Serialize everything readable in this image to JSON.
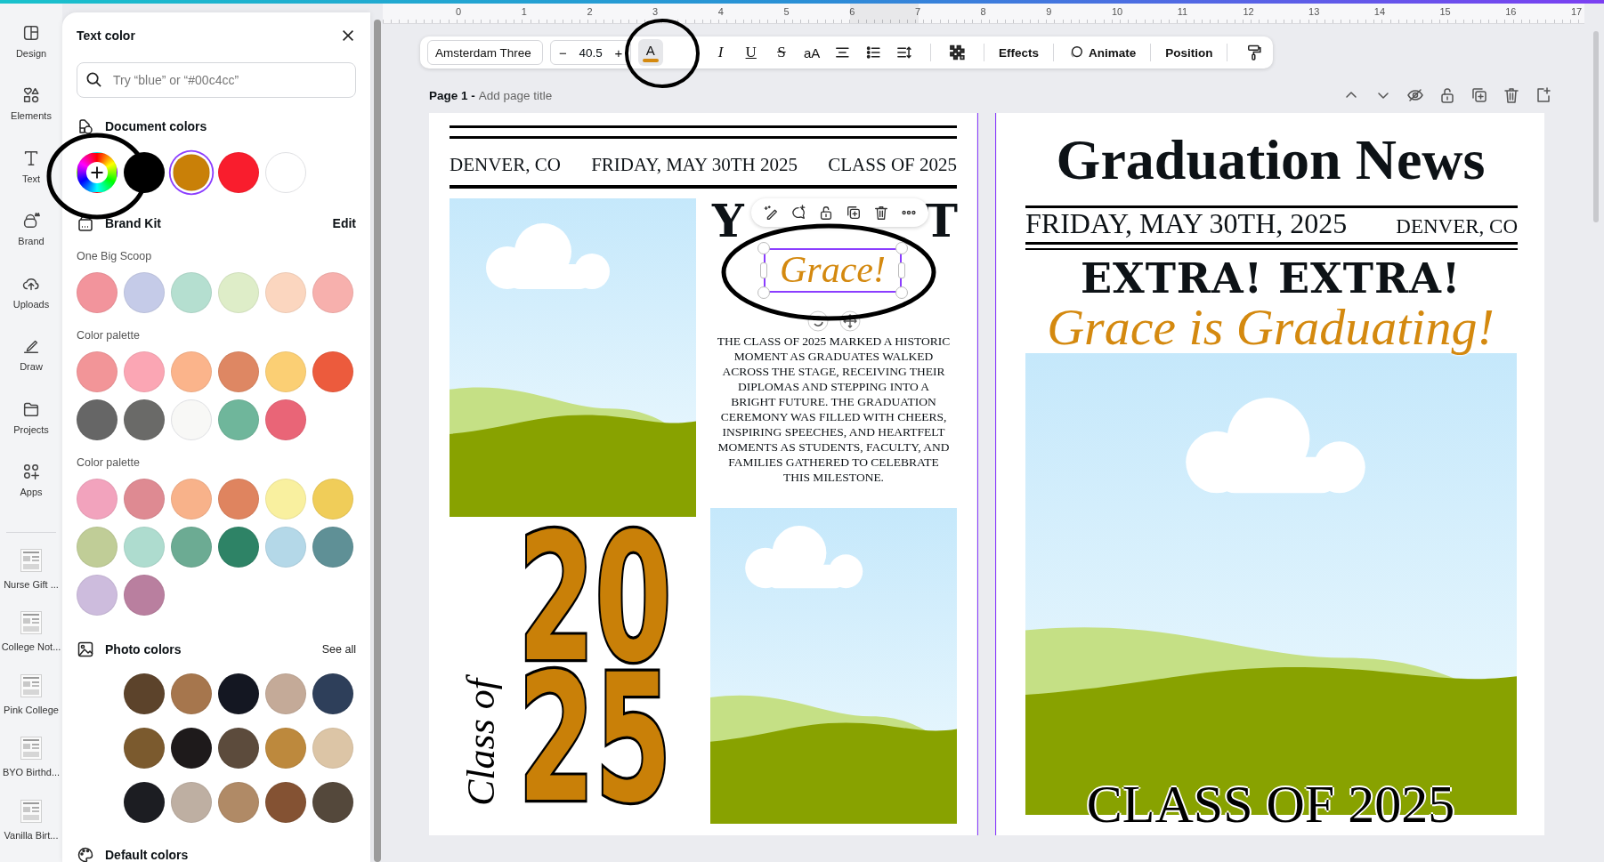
{
  "rail": {
    "items": [
      {
        "kind": "design",
        "label": "Design"
      },
      {
        "kind": "elements",
        "label": "Elements"
      },
      {
        "kind": "text",
        "label": "Text"
      },
      {
        "kind": "brand",
        "label": "Brand"
      },
      {
        "kind": "uploads",
        "label": "Uploads"
      },
      {
        "kind": "draw",
        "label": "Draw"
      },
      {
        "kind": "projects",
        "label": "Projects"
      },
      {
        "kind": "apps",
        "label": "Apps"
      }
    ],
    "recent": [
      {
        "label": "Nurse Gift ..."
      },
      {
        "label": "College Not..."
      },
      {
        "label": "Pink College"
      },
      {
        "label": "BYO Birthd..."
      },
      {
        "label": "Vanilla Birt..."
      }
    ]
  },
  "panel": {
    "title": "Text color",
    "search": {
      "placeholder": "Try “blue” or “#00c4cc”"
    },
    "document_colors": {
      "title": "Document colors",
      "swatches": [
        {
          "color": "#000000",
          "selected": false
        },
        {
          "color": "#c98008",
          "selected": true
        },
        {
          "color": "#f91d2d",
          "selected": false
        },
        {
          "color": "#ffffff",
          "selected": false
        }
      ]
    },
    "brand_kit": {
      "title": "Brand Kit",
      "action": "Edit",
      "palettes": [
        {
          "name": "One Big Scoop",
          "colors": [
            {
              "color": "#f2949c"
            },
            {
              "color": "#c5cbe8"
            },
            {
              "color": "#b5dfd0"
            },
            {
              "color": "#deedc8"
            },
            {
              "color": "#fbd6bf"
            },
            {
              "color": "#f7b0ad"
            }
          ]
        },
        {
          "name": "Color palette",
          "colors": [
            {
              "color": "#f29598"
            },
            {
              "color": "#fba6b4"
            },
            {
              "color": "#fbb48b"
            },
            {
              "color": "#de8763"
            },
            {
              "color": "#fbcf74"
            },
            {
              "color": "#ec5b3d"
            },
            {
              "color": "#666666"
            },
            {
              "color": "#6a6a68"
            },
            {
              "color": "#f8f8f6"
            },
            {
              "color": "#6fb69b"
            },
            {
              "color": "#e96577"
            }
          ]
        },
        {
          "name": "Color palette",
          "colors": [
            {
              "color": "#f2a3bd"
            },
            {
              "color": "#de8a92"
            },
            {
              "color": "#f8b28a"
            },
            {
              "color": "#df845f"
            },
            {
              "color": "#f9f09f"
            },
            {
              "color": "#f0cd59"
            },
            {
              "color": "#c0cd97"
            },
            {
              "color": "#aedccf"
            },
            {
              "color": "#6cab93"
            },
            {
              "color": "#2e8366"
            },
            {
              "color": "#b4d8e8"
            },
            {
              "color": "#5f9096"
            },
            {
              "color": "#cdbcdd"
            },
            {
              "color": "#b97f9f"
            }
          ]
        }
      ]
    },
    "photo_colors": {
      "title": "Photo colors",
      "action": "See all",
      "colors": [
        {
          "color": "#5c432b"
        },
        {
          "color": "#a6764d"
        },
        {
          "color": "#141722"
        },
        {
          "color": "#c4aa98"
        },
        {
          "color": "#2e3f5a"
        },
        {
          "color": "#7b5a2e"
        },
        {
          "color": "#1e1a1b"
        },
        {
          "color": "#5c4b3c"
        },
        {
          "color": "#bd893d"
        },
        {
          "color": "#dcc5a6"
        },
        {
          "color": "#1c1d22"
        },
        {
          "color": "#beafa2"
        },
        {
          "color": "#b08a66"
        },
        {
          "color": "#845233"
        },
        {
          "color": "#54483b"
        }
      ]
    },
    "default_colors": {
      "title": "Default colors"
    }
  },
  "ruler": [
    "0",
    "1",
    "2",
    "3",
    "4",
    "5",
    "6",
    "7",
    "8",
    "9",
    "10",
    "11",
    "12",
    "13",
    "14",
    "15",
    "16",
    "17"
  ],
  "toolbar": {
    "font": "Amsterdam Three",
    "size": {
      "minus": "−",
      "value": "40.5",
      "plus": "+"
    },
    "text_color": {
      "label": "A",
      "color": "#d4890f"
    },
    "format": [
      {
        "kind": "italic",
        "label": "I"
      },
      {
        "kind": "underline",
        "label": "U"
      },
      {
        "kind": "strike",
        "label": "S"
      },
      {
        "kind": "case",
        "label": "aA"
      }
    ],
    "effects": "Effects",
    "animate": "Animate",
    "position": "Position"
  },
  "page_header": {
    "label": "Page 1 -",
    "placeholder": "Add page title"
  },
  "left_page": {
    "header": [
      "DENVER, CO",
      "FRIDAY, MAY 30TH 2025",
      "CLASS OF 2025"
    ],
    "headline": [
      "Y",
      "T"
    ],
    "selected_text": "Grace!",
    "story": "THE CLASS OF 2025 MARKED A HISTORIC MOMENT AS GRADUATES WALKED ACROSS THE STAGE, RECEIVING THEIR DIPLOMAS AND STEPPING INTO A BRIGHT FUTURE. THE GRADUATION CEREMONY WAS FILLED WITH CHEERS, INSPIRING SPEECHES, AND HEARTFELT MOMENTS AS STUDENTS, FACULTY, AND FAMILIES GATHERED TO CELEBRATE THIS MILESTONE.",
    "year_badge": {
      "caption": "Class of",
      "lines": [
        "20",
        "25"
      ]
    }
  },
  "right_page": {
    "title": "Graduation News",
    "date": "FRIDAY, MAY 30TH, 2025",
    "place": "DENVER, CO",
    "headline": "EXTRA! EXTRA!",
    "subhead": "Grace is Graduating!",
    "footer": "CLASS OF 2025"
  }
}
